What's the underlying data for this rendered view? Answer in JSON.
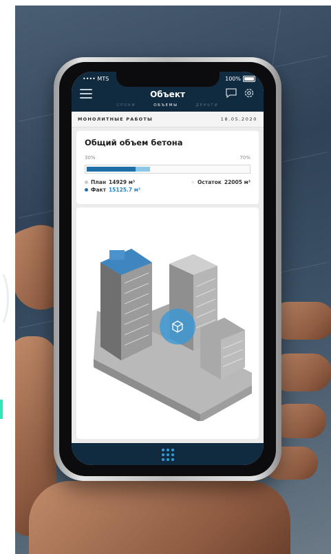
{
  "status_bar": {
    "carrier": "•••• MTS",
    "battery": "100%"
  },
  "header": {
    "title": "Объект",
    "tabs": [
      {
        "label": "СРОКИ",
        "active": false
      },
      {
        "label": "ОБЪЕМЫ",
        "active": true
      },
      {
        "label": "ДЕНЬГИ",
        "active": false
      }
    ]
  },
  "section": {
    "title": "МОНОЛИТНЫЕ РАБОТЫ",
    "date": "18.05.2020"
  },
  "concrete_card": {
    "title": "Общий объем бетона",
    "fact_percent_label": "30%",
    "plan_percent_label": "70%",
    "fact_fraction": 0.3,
    "plan_fraction": 0.39,
    "plan_label": "План",
    "plan_value": "14929 м³",
    "fact_label": "Факт",
    "fact_value": "15125.7 м³",
    "remainder_label": "Остаток",
    "remainder_value": "22005 м³"
  },
  "colors": {
    "header_bg": "#102a3f",
    "accent_blue": "#1e6ea8",
    "light_blue": "#8ac7e6",
    "tab_inactive": "#53708a",
    "side_accent": "#2ee6b8"
  },
  "icons": {
    "menu": "hamburger-icon",
    "chat": "chat-bubble-icon",
    "settings": "gear-icon",
    "model": "cube-icon",
    "apps": "grid-dots-icon"
  }
}
